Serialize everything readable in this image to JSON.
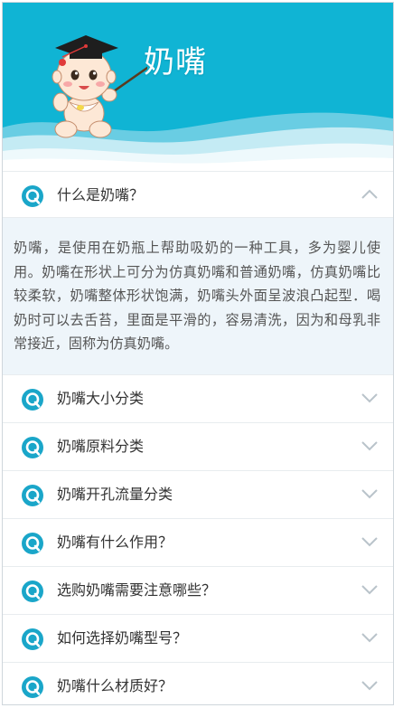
{
  "header": {
    "title": "奶嘴"
  },
  "faq": {
    "expanded": {
      "question": "什么是奶嘴？",
      "answer": "奶嘴，是使用在奶瓶上帮助吸奶的一种工具，多为婴儿使用。奶嘴在形状上可分为仿真奶嘴和普通奶嘴，仿真奶嘴比较柔软，奶嘴整体形状饱满，奶嘴头外面呈波浪凸起型．喝奶时可以去舌苔，里面是平滑的，容易清洗，因为和母乳非常接近，固称为仿真奶嘴。"
    },
    "items": [
      {
        "question": "奶嘴大小分类"
      },
      {
        "question": "奶嘴原料分类"
      },
      {
        "question": "奶嘴开孔流量分类"
      },
      {
        "question": "奶嘴有什么作用？"
      },
      {
        "question": "选购奶嘴需要注意哪些？"
      },
      {
        "question": "如何选择奶嘴型号？"
      },
      {
        "question": "奶嘴什么材质好？"
      }
    ]
  },
  "colors": {
    "brand": "#10b4d4",
    "icon": "#1aa6c9",
    "answer_bg": "#eef5fa"
  },
  "icons": {
    "question": "q-icon",
    "expanded": "chevron-up-icon",
    "collapsed": "chevron-down-icon"
  }
}
